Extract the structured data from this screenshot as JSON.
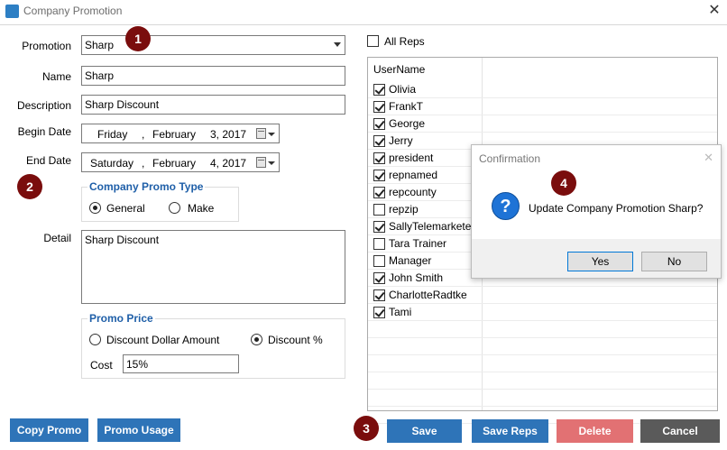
{
  "window": {
    "title": "Company Promotion",
    "close_glyph": "✕"
  },
  "form": {
    "promotion_label": "Promotion",
    "promotion_value": "Sharp",
    "name_label": "Name",
    "name_value": "Sharp",
    "description_label": "Description",
    "description_value": "Sharp Discount",
    "begin_date_label": "Begin Date",
    "begin_date": {
      "weekday": "Friday",
      "sep": ",",
      "month": "February",
      "day_year": "3, 2017"
    },
    "end_date_label": "End Date",
    "end_date": {
      "weekday": "Saturday",
      "sep": ",",
      "month": "February",
      "day_year": "4, 2017"
    },
    "promo_type": {
      "title": "Company Promo Type",
      "options": [
        "General",
        "Make"
      ],
      "selected": "General"
    },
    "detail_label": "Detail",
    "detail_value": "Sharp Discount",
    "promo_price": {
      "title": "Promo Price",
      "options": [
        "Discount Dollar Amount",
        "Discount %"
      ],
      "selected": "Discount %",
      "cost_label": "Cost",
      "cost_value": "15%"
    }
  },
  "reps": {
    "all_reps_label": "All Reps",
    "all_reps_checked": false,
    "column_header": "UserName",
    "users": [
      {
        "name": "Olivia",
        "checked": true
      },
      {
        "name": "FrankT",
        "checked": true
      },
      {
        "name": "George",
        "checked": true
      },
      {
        "name": "Jerry",
        "checked": true
      },
      {
        "name": "president",
        "checked": true
      },
      {
        "name": "repnamed",
        "checked": true
      },
      {
        "name": "repcounty",
        "checked": true
      },
      {
        "name": "repzip",
        "checked": false
      },
      {
        "name": "SallyTelemarketer",
        "checked": true
      },
      {
        "name": "Tara Trainer",
        "checked": false
      },
      {
        "name": "Manager",
        "checked": false
      },
      {
        "name": "John Smith",
        "checked": true
      },
      {
        "name": "CharlotteRadtke",
        "checked": true
      },
      {
        "name": "Tami",
        "checked": true
      }
    ]
  },
  "buttons": {
    "copy_promo": "Copy Promo",
    "promo_usage": "Promo Usage",
    "save": "Save",
    "save_reps": "Save Reps",
    "delete": "Delete",
    "cancel": "Cancel"
  },
  "dialog": {
    "title": "Confirmation",
    "close_glyph": "✕",
    "icon_glyph": "?",
    "message": "Update Company Promotion Sharp?",
    "yes_label": "Yes",
    "no_label": "No"
  },
  "badges": [
    "1",
    "2",
    "3",
    "4"
  ],
  "colors": {
    "primary_button": "#2e74b8",
    "delete_button": "#e27173",
    "cancel_button": "#5a5a5a",
    "badge": "#7a0d0d",
    "group_title": "#1f5fa8"
  }
}
